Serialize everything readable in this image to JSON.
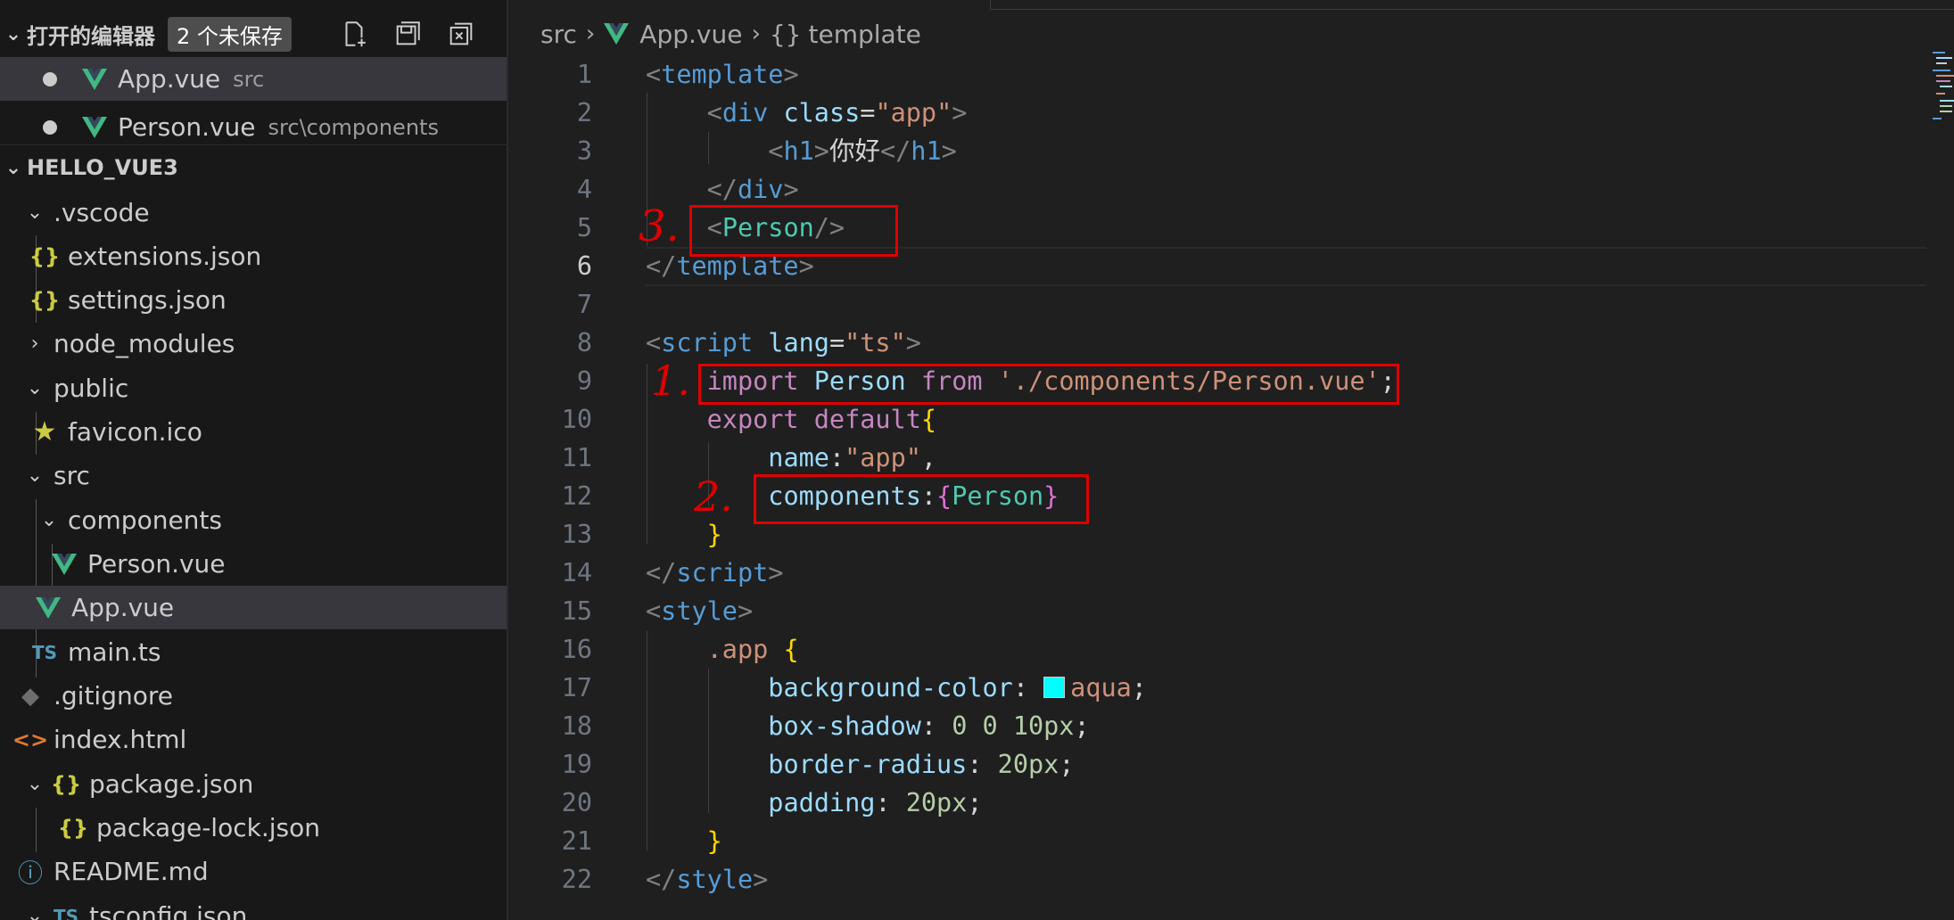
{
  "sidebar": {
    "open_editors": {
      "title": "打开的编辑器",
      "badge": "2 个未保存",
      "items": [
        {
          "name": "App.vue",
          "path": "src"
        },
        {
          "name": "Person.vue",
          "path": "src\\components"
        }
      ]
    },
    "project": {
      "title": "HELLO_VUE3",
      "items": [
        {
          "label": ".vscode"
        },
        {
          "label": "extensions.json"
        },
        {
          "label": "settings.json"
        },
        {
          "label": "node_modules"
        },
        {
          "label": "public"
        },
        {
          "label": "favicon.ico"
        },
        {
          "label": "src"
        },
        {
          "label": "components"
        },
        {
          "label": "Person.vue"
        },
        {
          "label": "App.vue"
        },
        {
          "label": "main.ts"
        },
        {
          "label": ".gitignore"
        },
        {
          "label": "index.html"
        },
        {
          "label": "package.json"
        },
        {
          "label": "package-lock.json"
        },
        {
          "label": "README.md"
        },
        {
          "label": "tsconfig.json"
        }
      ]
    },
    "icons": {
      "ts_label": "TS",
      "json_label": "{}",
      "html_label": "<>"
    }
  },
  "breadcrumb": {
    "folder": "src",
    "file": "App.vue",
    "symbol_icon": "{}",
    "symbol": "template"
  },
  "editor": {
    "line_numbers": [
      "1",
      "2",
      "3",
      "4",
      "5",
      "6",
      "7",
      "8",
      "9",
      "10",
      "11",
      "12",
      "13",
      "14",
      "15",
      "16",
      "17",
      "18",
      "19",
      "20",
      "21",
      "22"
    ],
    "active_line": "6",
    "annotations": [
      "3.",
      "1.",
      "2."
    ],
    "swatch_color": "#00ffff"
  },
  "colors": {
    "vue_green": "#41b883",
    "red_annotation": "#e00000",
    "selected_row": "#37373d"
  }
}
